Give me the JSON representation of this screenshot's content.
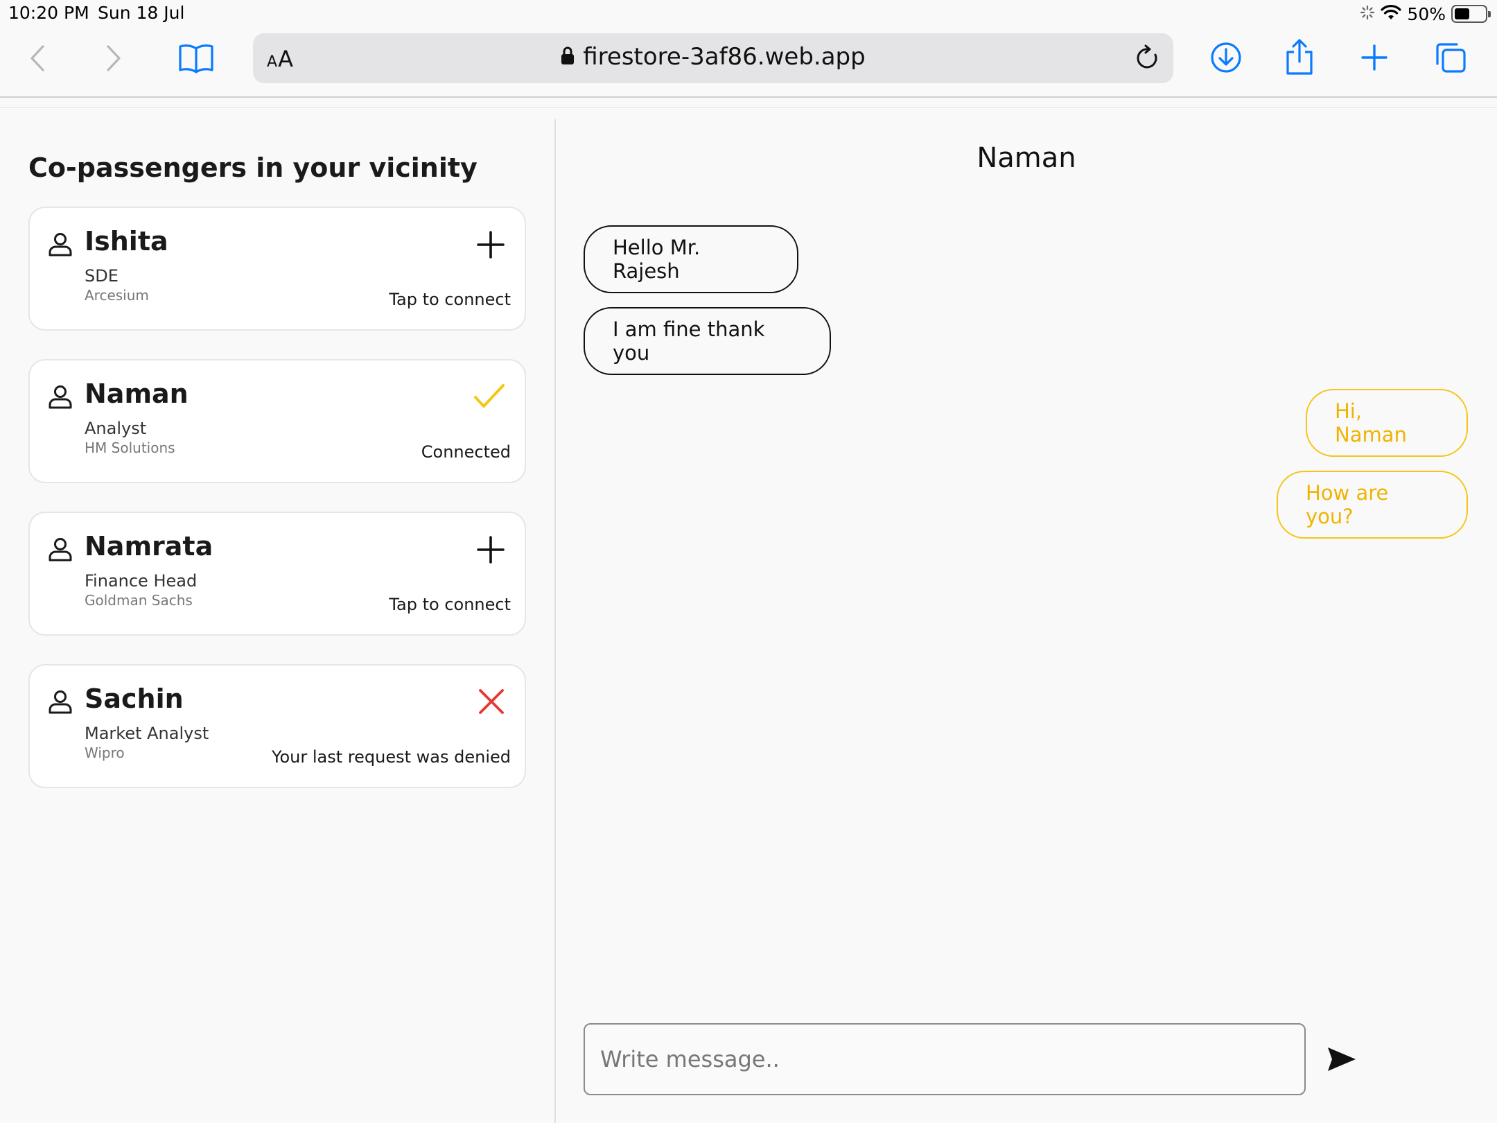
{
  "status_bar": {
    "time": "10:20 PM",
    "date": "Sun 18 Jul",
    "battery": "50%",
    "battery_level": 0.5
  },
  "browser": {
    "text_size_label_small": "A",
    "text_size_label_large": "A",
    "url": "firestore-3af86.web.app",
    "icons": [
      "back-icon",
      "forward-icon",
      "bookmarks-icon",
      "lock-icon",
      "reload-icon",
      "download-icon",
      "share-icon",
      "new-tab-icon",
      "tabs-icon"
    ]
  },
  "sidebar": {
    "title": "Co-passengers in your vicinity",
    "passengers": [
      {
        "name": "Ishita",
        "role": "SDE",
        "company": "Arcesium",
        "status": "Tap to connect",
        "icon": "plus-icon"
      },
      {
        "name": "Naman",
        "role": "Analyst",
        "company": "HM Solutions",
        "status": "Connected",
        "icon": "check-icon"
      },
      {
        "name": "Namrata",
        "role": "Finance Head",
        "company": "Goldman Sachs",
        "status": "Tap to connect",
        "icon": "plus-icon"
      },
      {
        "name": "Sachin",
        "role": "Market Analyst",
        "company": "Wipro",
        "status": "Your last request was denied",
        "icon": "cross-icon"
      }
    ]
  },
  "chat": {
    "contact_name": "Naman",
    "messages": [
      {
        "text": "Hello Mr. Rajesh",
        "direction": "incoming"
      },
      {
        "text": "I am fine thank you",
        "direction": "incoming"
      },
      {
        "text": "Hi, Naman",
        "direction": "outgoing"
      },
      {
        "text": "How are you?",
        "direction": "outgoing"
      }
    ],
    "input_placeholder": "Write message..",
    "input_value": ""
  },
  "colors": {
    "accent": "#F5C518",
    "accent_text": "#F0B400",
    "denied": "#E53935",
    "ios_blue": "#0A7AFF"
  }
}
